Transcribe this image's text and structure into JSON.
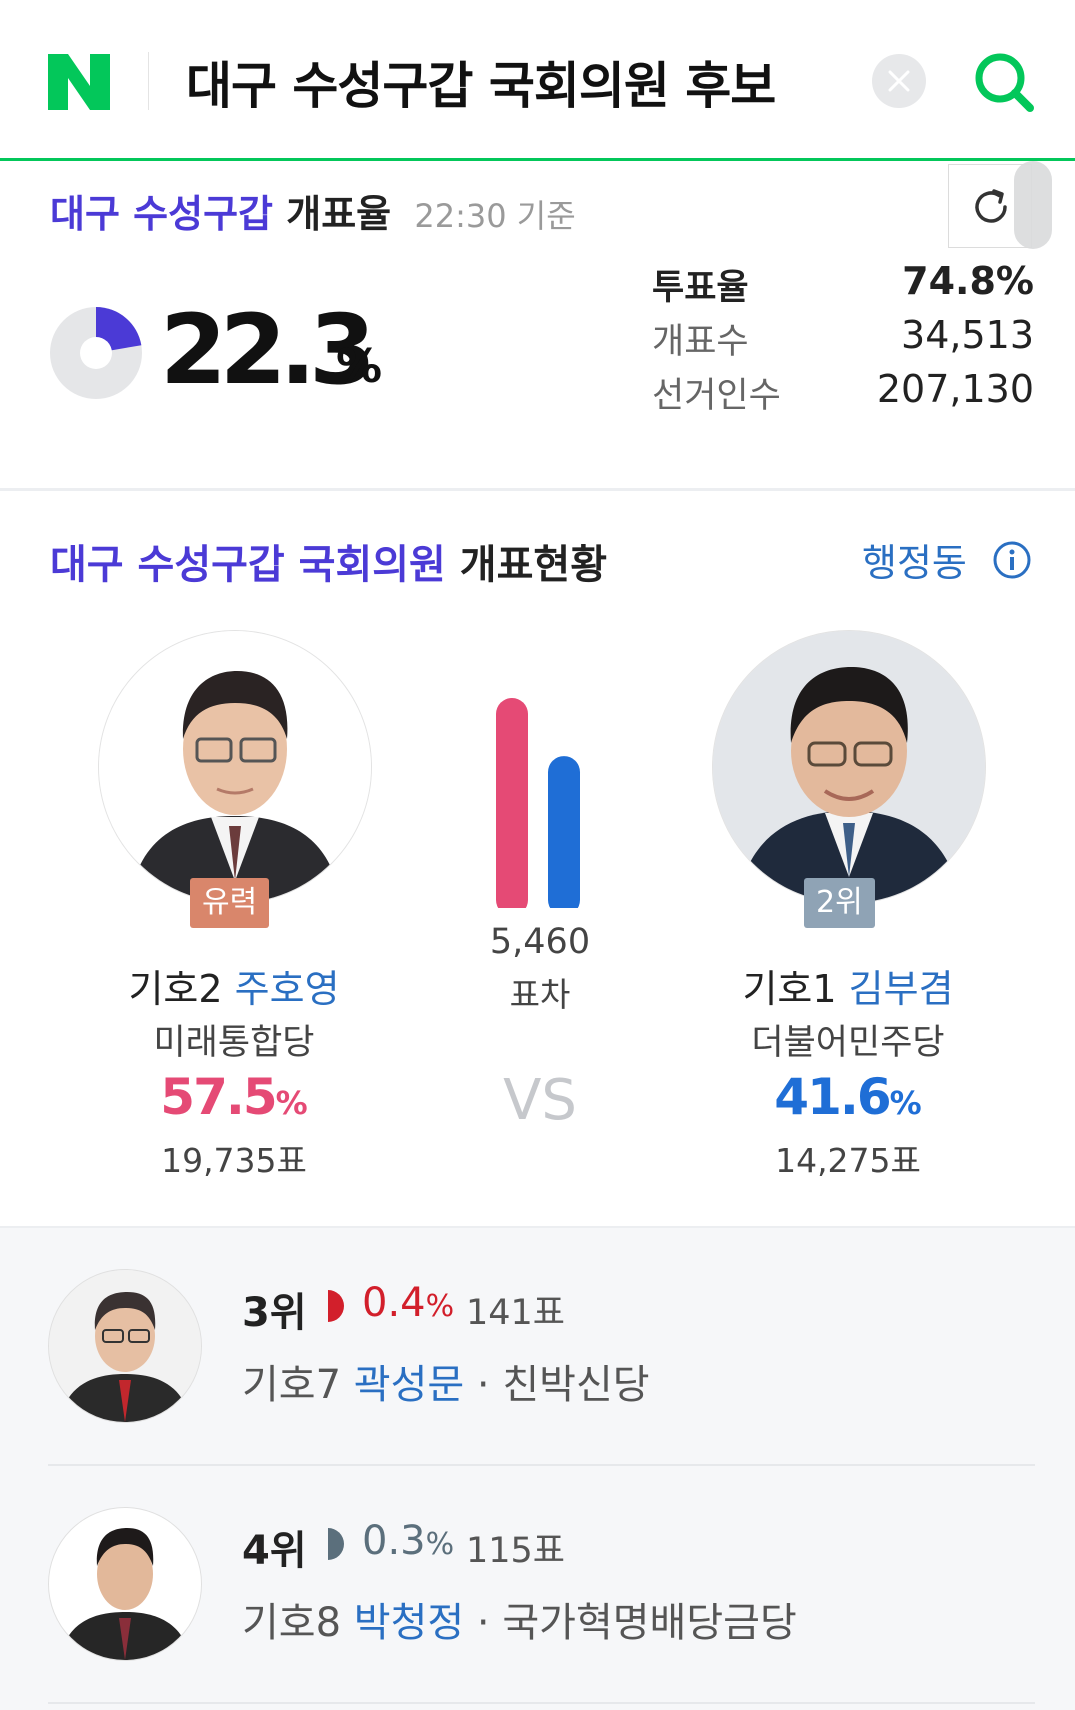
{
  "header": {
    "logo": "N",
    "query": "대구 수성구갑 국회의원 후보",
    "icons": [
      "naver-logo",
      "clear-icon",
      "search-icon"
    ]
  },
  "turnout": {
    "region": "대구 수성구갑",
    "label": "개표율",
    "time": "22:30 기준",
    "count_rate": "22.3",
    "count_rate_unit": "%",
    "count_rate_value": 22.3,
    "stats": [
      {
        "key": "투표율",
        "value": "74.8%"
      },
      {
        "key": "개표수",
        "value": "34,513"
      },
      {
        "key": "선거인수",
        "value": "207,130"
      }
    ],
    "colors": {
      "accent": "#4b3ad6",
      "pie_track": "#e5e6e8"
    }
  },
  "results": {
    "title_colored": "대구 수성구갑 국회의원",
    "title_black": "개표현황",
    "admin_link": "행정동",
    "gap": "5,460",
    "gap_label": "표차",
    "vs": "VS",
    "bar_values": [
      57.5,
      41.6
    ],
    "candidates": [
      {
        "badge": "유력",
        "prefix": "기호2",
        "name": "주호영",
        "party": "미래통합당",
        "pct": "57.5",
        "pct_unit": "%",
        "votes": "19,735표",
        "color": "#e54a75",
        "badge_color": "#d9866b"
      },
      {
        "badge": "2위",
        "prefix": "기호1",
        "name": "김부겸",
        "party": "더불어민주당",
        "pct": "41.6",
        "pct_unit": "%",
        "votes": "14,275표",
        "color": "#1f6ed6",
        "badge_color": "#8fa3b5"
      }
    ]
  },
  "others": [
    {
      "rank": "3위",
      "pct": "0.4",
      "pct_unit": "%",
      "pct_value": 0.4,
      "votes": "141표",
      "prefix": "기호7",
      "name": "곽성문",
      "party": "친박신당",
      "dot": " · ",
      "color": "#d21f2b"
    },
    {
      "rank": "4위",
      "pct": "0.3",
      "pct_unit": "%",
      "pct_value": 0.3,
      "votes": "115표",
      "prefix": "기호8",
      "name": "박청정",
      "party": "국가혁명배당금당",
      "dot": " · ",
      "color": "#5b6f7c"
    }
  ]
}
